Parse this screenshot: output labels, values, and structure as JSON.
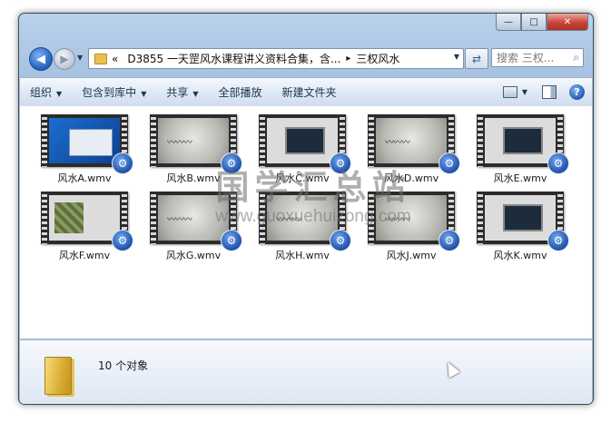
{
  "window": {
    "caption": {
      "minimize_glyph": "—",
      "maximize_glyph": "□",
      "close_glyph": "✕"
    }
  },
  "nav": {
    "back_glyph": "◀",
    "forward_glyph": "▶",
    "address": {
      "overflow": "«",
      "segment_1": "D3855 一天罡风水课程讲义资料合集，含...",
      "separator": "▸",
      "segment_2": "三权风水"
    },
    "refresh_glyph": "⇄",
    "search": {
      "placeholder": "搜索 三权...",
      "icon": "magnifier-icon"
    }
  },
  "toolbar": {
    "organize": "组织",
    "include_in_library": "包含到库中",
    "share": "共享",
    "play_all": "全部播放",
    "new_folder": "新建文件夹",
    "dropdown_glyph": "▼",
    "help_glyph": "?"
  },
  "files": [
    {
      "name": "风水A.wmv",
      "thumb": "desktop"
    },
    {
      "name": "风水B.wmv",
      "thumb": "paper"
    },
    {
      "name": "风水C.wmv",
      "thumb": "slide"
    },
    {
      "name": "风水D.wmv",
      "thumb": "paper"
    },
    {
      "name": "风水E.wmv",
      "thumb": "slide"
    },
    {
      "name": "风水F.wmv",
      "thumb": "map"
    },
    {
      "name": "风水G.wmv",
      "thumb": "paper"
    },
    {
      "name": "风水H.wmv",
      "thumb": "paper"
    },
    {
      "name": "风水J.wmv",
      "thumb": "paper"
    },
    {
      "name": "风水K.wmv",
      "thumb": "slide"
    }
  ],
  "badge_glyph": "⚙",
  "details": {
    "count": "10 个对象"
  },
  "watermark": {
    "text": "国学汇总站",
    "url": "www.guoxuehuizong.com"
  },
  "colors": {
    "accent": "#1d4fa6",
    "window_frame": "#a9c4e3",
    "folder": "#e7c152"
  }
}
